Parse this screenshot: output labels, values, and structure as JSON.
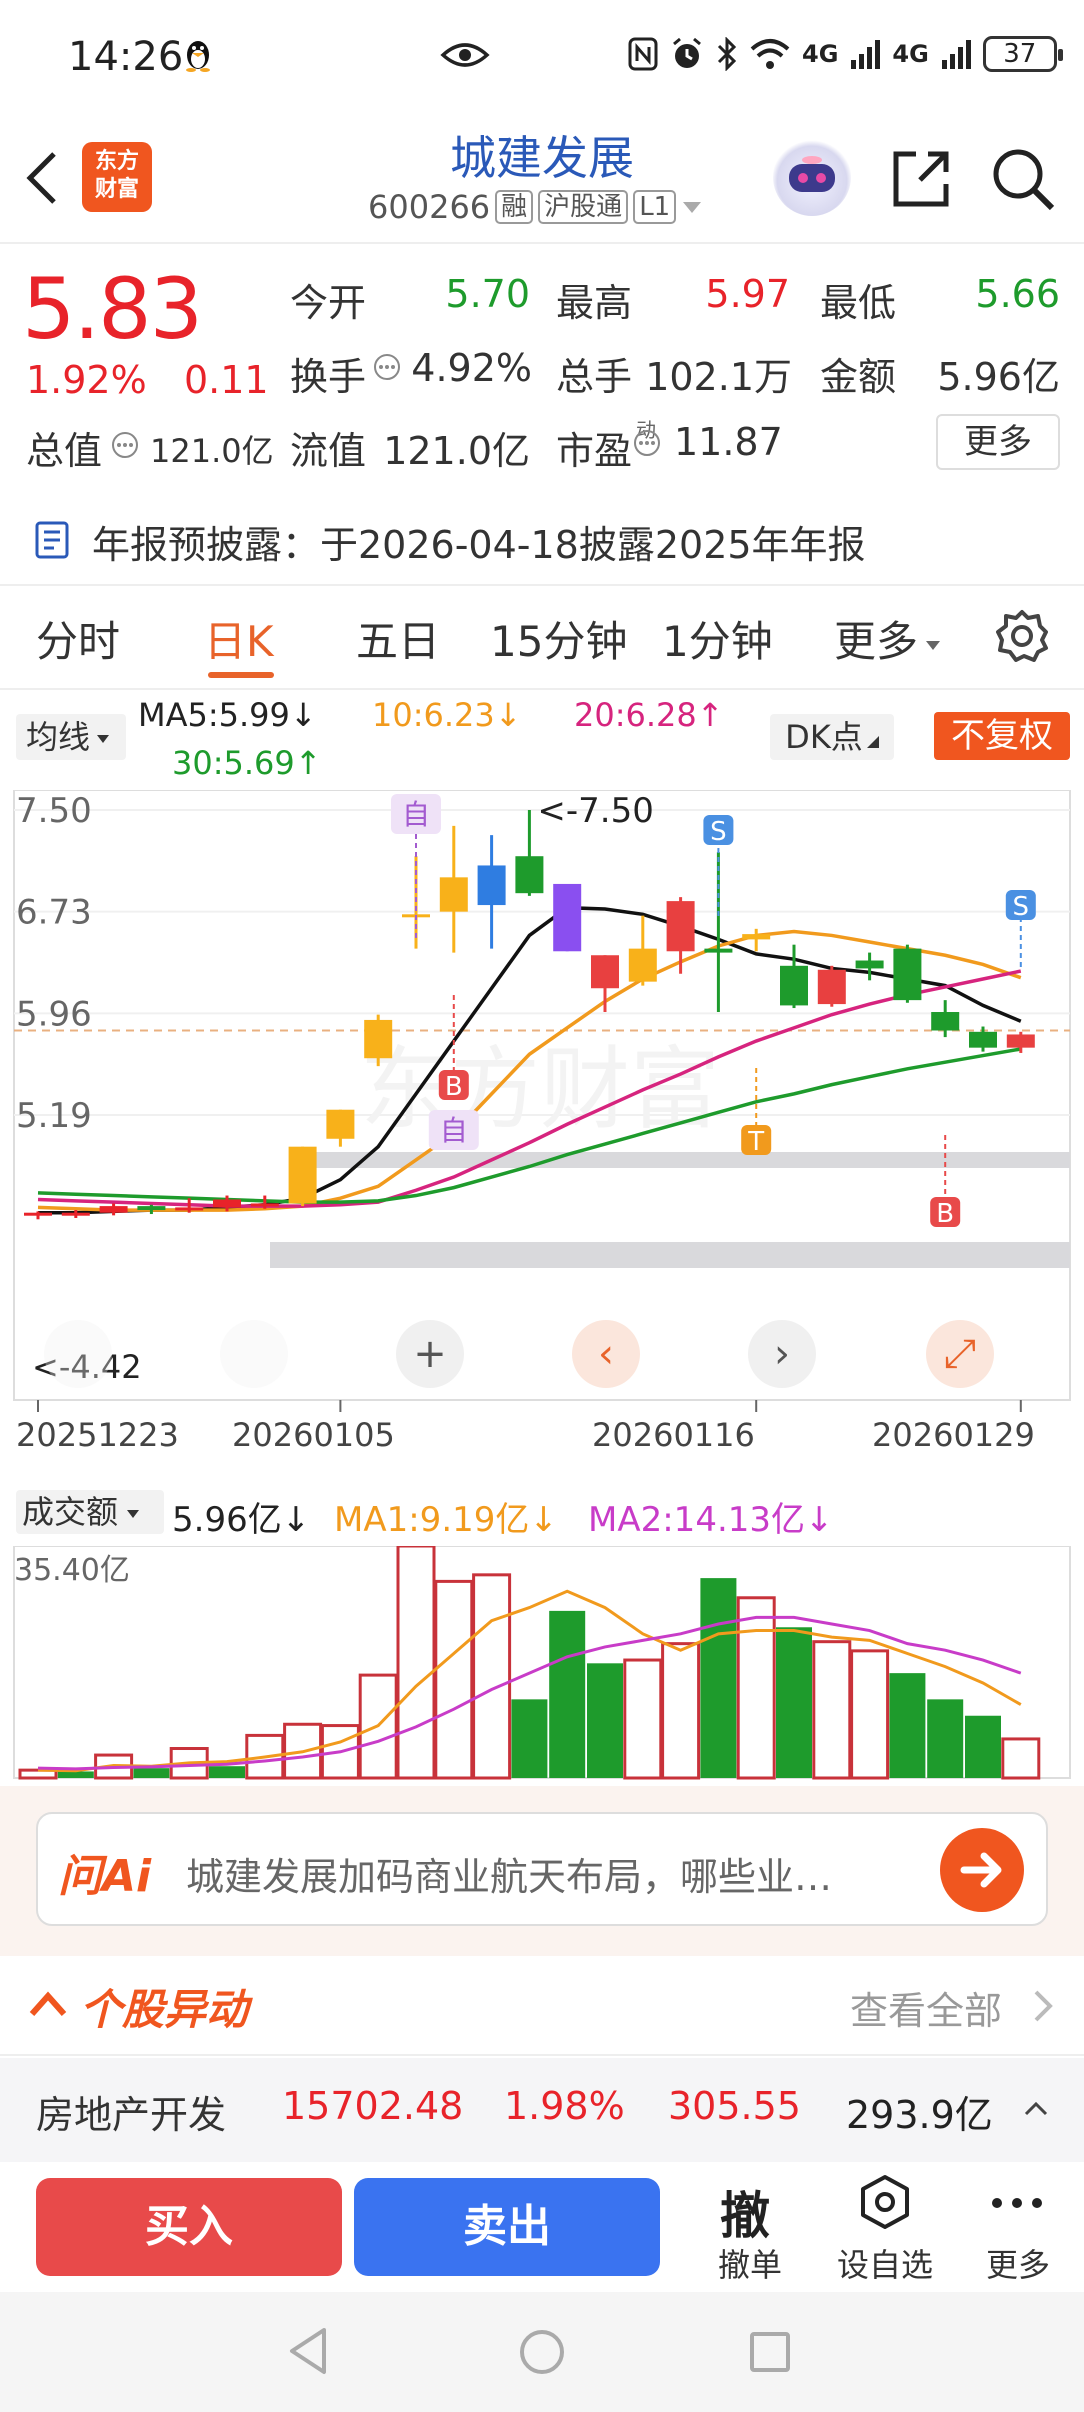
{
  "status": {
    "time": "14:26",
    "battery": "37",
    "signal1": "4G",
    "signal2": "4G"
  },
  "nav": {
    "stock_name": "城建发展",
    "code": "600266",
    "tag1": "融",
    "tag2": "沪股通",
    "tag3": "L1",
    "logo_line1": "东方",
    "logo_line2": "财富"
  },
  "quote": {
    "price": "5.83",
    "pct": "1.92%",
    "chg": "0.11",
    "mcap_label": "总值",
    "mcap_value": "121.0亿",
    "open_label": "今开",
    "open": "5.70",
    "high_label": "最高",
    "high": "5.97",
    "low_label": "最低",
    "low": "5.66",
    "turnover_label": "换手",
    "turnover": "4.92%",
    "vol_label": "总手",
    "vol": "102.1万",
    "amount_label": "金额",
    "amount": "5.96亿",
    "float_label": "流值",
    "float": "121.0亿",
    "pe_label": "市盈",
    "pe_sup": "动",
    "pe": "11.87",
    "more": "更多"
  },
  "notice": {
    "text": "年报预披露：于2026-04-18披露2025年年报"
  },
  "tabs": [
    "分时",
    "日K",
    "五日",
    "15分钟",
    "1分钟",
    "更多"
  ],
  "ma": {
    "select": "均线",
    "ma5": "MA5:5.99↓",
    "ma10": "10:6.23↓",
    "ma20": "20:6.28↑",
    "ma30": "30:5.69↑",
    "dk": "DK点",
    "fq": "不复权"
  },
  "chart_data": [
    {
      "type": "candlestick",
      "title": "",
      "y_ticks": [
        "7.50",
        "6.73",
        "5.96",
        "5.19"
      ],
      "x_ticks": [
        "20251223",
        "20260105",
        "20260116",
        "20260129"
      ],
      "annotations": {
        "max": "<-7.50",
        "min": "<-4.42",
        "self1": "自",
        "self2": "自"
      },
      "signals": [
        "S",
        "B",
        "T",
        "S",
        "B"
      ],
      "candles": [
        {
          "o": 4.43,
          "c": 4.45,
          "h": 4.46,
          "l": 4.4
        },
        {
          "o": 4.44,
          "c": 4.45,
          "h": 4.47,
          "l": 4.41
        },
        {
          "o": 4.45,
          "c": 4.5,
          "h": 4.52,
          "l": 4.43
        },
        {
          "o": 4.5,
          "c": 4.47,
          "h": 4.51,
          "l": 4.44
        },
        {
          "o": 4.47,
          "c": 4.49,
          "h": 4.56,
          "l": 4.45
        },
        {
          "o": 4.49,
          "c": 4.55,
          "h": 4.58,
          "l": 4.46
        },
        {
          "o": 4.5,
          "c": 4.52,
          "h": 4.58,
          "l": 4.48
        },
        {
          "o": 4.52,
          "c": 4.95,
          "h": 4.95,
          "l": 4.5
        },
        {
          "o": 5.01,
          "c": 5.23,
          "h": 5.23,
          "l": 4.95
        },
        {
          "o": 5.62,
          "c": 5.91,
          "h": 5.95,
          "l": 5.56
        },
        {
          "o": 6.71,
          "c": 6.71,
          "h": 7.15,
          "l": 6.45
        },
        {
          "o": 6.73,
          "c": 6.99,
          "h": 7.38,
          "l": 6.42
        },
        {
          "o": 7.08,
          "c": 6.78,
          "h": 7.31,
          "l": 6.45
        },
        {
          "o": 7.15,
          "c": 6.87,
          "h": 7.5,
          "l": 6.85
        },
        {
          "o": 6.94,
          "c": 6.43,
          "h": 6.94,
          "l": 6.43
        },
        {
          "o": 6.4,
          "c": 6.15,
          "h": 6.4,
          "l": 5.97
        },
        {
          "o": 6.2,
          "c": 6.45,
          "h": 6.7,
          "l": 6.17
        },
        {
          "o": 6.81,
          "c": 6.43,
          "h": 6.84,
          "l": 6.26
        },
        {
          "o": 6.45,
          "c": 6.42,
          "h": 7.18,
          "l": 5.97
        },
        {
          "o": 6.52,
          "c": 6.56,
          "h": 6.6,
          "l": 6.43
        },
        {
          "o": 6.32,
          "c": 6.02,
          "h": 6.48,
          "l": 6.0
        },
        {
          "o": 6.03,
          "c": 6.29,
          "h": 6.32,
          "l": 6.01
        },
        {
          "o": 6.36,
          "c": 6.3,
          "h": 6.42,
          "l": 6.21
        },
        {
          "o": 6.45,
          "c": 6.06,
          "h": 6.48,
          "l": 6.04
        },
        {
          "o": 5.97,
          "c": 5.83,
          "h": 6.06,
          "l": 5.78
        },
        {
          "o": 5.82,
          "c": 5.7,
          "h": 5.86,
          "l": 5.67
        },
        {
          "o": 5.7,
          "c": 5.8,
          "h": 5.82,
          "l": 5.66
        }
      ],
      "series": [
        {
          "name": "MA5",
          "color": "#111111",
          "values": [
            4.45,
            4.45,
            4.46,
            4.47,
            4.47,
            4.49,
            4.51,
            4.56,
            4.7,
            4.95,
            5.35,
            5.75,
            6.15,
            6.55,
            6.76,
            6.75,
            6.71,
            6.62,
            6.52,
            6.41,
            6.37,
            6.3,
            6.27,
            6.22,
            6.17,
            6.02,
            5.9
          ]
        },
        {
          "name": "MA10",
          "color": "#f19a1d",
          "values": [
            4.49,
            4.48,
            4.47,
            4.47,
            4.47,
            4.47,
            4.48,
            4.5,
            4.56,
            4.65,
            4.85,
            5.05,
            5.35,
            5.65,
            5.85,
            6.05,
            6.22,
            6.35,
            6.47,
            6.55,
            6.58,
            6.55,
            6.5,
            6.45,
            6.4,
            6.33,
            6.23
          ]
        },
        {
          "name": "MA20",
          "color": "#d6247e",
          "values": [
            4.55,
            4.54,
            4.53,
            4.52,
            4.51,
            4.5,
            4.5,
            4.5,
            4.51,
            4.53,
            4.62,
            4.72,
            4.85,
            4.98,
            5.12,
            5.25,
            5.38,
            5.5,
            5.63,
            5.75,
            5.85,
            5.95,
            6.03,
            6.1,
            6.16,
            6.22,
            6.28
          ]
        },
        {
          "name": "MA30",
          "color": "#1e9b2c",
          "values": [
            4.6,
            4.59,
            4.58,
            4.57,
            4.56,
            4.55,
            4.54,
            4.53,
            4.53,
            4.54,
            4.58,
            4.64,
            4.72,
            4.8,
            4.89,
            4.97,
            5.05,
            5.13,
            5.21,
            5.29,
            5.35,
            5.42,
            5.48,
            5.54,
            5.59,
            5.64,
            5.69
          ]
        }
      ]
    },
    {
      "type": "bar",
      "title": "",
      "ymax_label": "35.40亿",
      "values": [
        1.2,
        1.0,
        3.5,
        1.5,
        4.5,
        1.8,
        6.5,
        8.2,
        8.0,
        15.7,
        35.4,
        30.0,
        31.0,
        12.0,
        25.5,
        17.5,
        18.0,
        20.5,
        30.5,
        27.5,
        23.0,
        20.8,
        19.4,
        16.0,
        12.0,
        9.5,
        5.96
      ],
      "up": [
        true,
        false,
        true,
        false,
        true,
        false,
        true,
        true,
        true,
        true,
        true,
        true,
        true,
        false,
        false,
        false,
        true,
        true,
        false,
        true,
        false,
        true,
        true,
        false,
        false,
        false,
        true
      ],
      "series": [
        {
          "name": "MA1",
          "color": "#f19a1d",
          "values": [
            1.2,
            1.1,
            1.9,
            1.8,
            2.3,
            2.5,
            3.2,
            4.0,
            5.5,
            8.0,
            14.0,
            19.0,
            24.0,
            26.0,
            28.5,
            26.0,
            22.0,
            19.5,
            22.0,
            22.5,
            22.5,
            21.5,
            21.0,
            19.0,
            17.0,
            14.5,
            11.2
          ]
        },
        {
          "name": "MA2",
          "color": "#c83cc8",
          "values": [
            1.5,
            1.4,
            1.6,
            1.7,
            1.9,
            2.1,
            2.6,
            3.2,
            4.0,
            5.6,
            7.8,
            10.5,
            13.5,
            16.0,
            18.5,
            20.0,
            21.0,
            22.0,
            23.5,
            24.5,
            24.5,
            23.5,
            22.5,
            20.5,
            19.5,
            18.0,
            16.0
          ]
        }
      ]
    }
  ],
  "volume": {
    "select": "成交额",
    "value": "5.96亿↓",
    "ma1": "MA1:9.19亿↓",
    "ma2": "MA2:14.13亿↓"
  },
  "ai": {
    "logo": "问Ai",
    "text": "城建发展加码商业航天布局，哪些业…"
  },
  "abnormal": {
    "title": "个股异动",
    "all": "查看全部"
  },
  "sector": {
    "name": "房地产开发",
    "index": "15702.48",
    "pct": "1.98%",
    "chg": "305.55",
    "amount": "293.9亿"
  },
  "bottom": {
    "buy": "买入",
    "sell": "卖出",
    "cancel_icon": "撤",
    "cancel": "撤单",
    "watch": "设自选",
    "more": "更多"
  }
}
